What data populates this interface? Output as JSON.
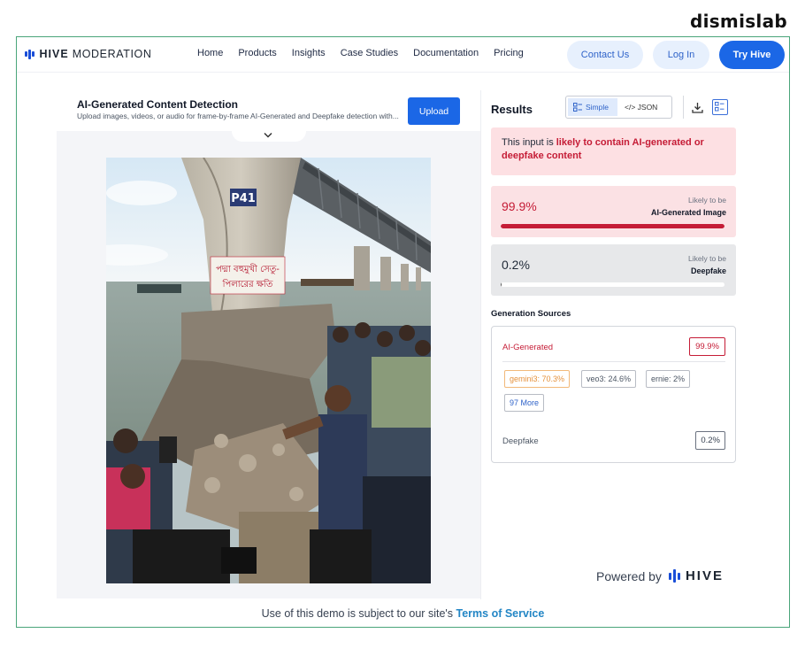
{
  "watermark": "dismislab",
  "header": {
    "brand_bold": "HIVE",
    "brand_rest": "MODERATION",
    "nav": [
      "Home",
      "Products",
      "Insights",
      "Case Studies",
      "Documentation",
      "Pricing"
    ],
    "contact_label": "Contact Us",
    "login_label": "Log In",
    "try_label": "Try Hive"
  },
  "detector": {
    "title": "AI-Generated Content Detection",
    "subtitle": "Upload images, videos, or audio for frame-by-frame AI-Generated and Deepfake detection with...",
    "upload_label": "Upload",
    "photo": {
      "pillar_code": "P41",
      "banner_line1": "পদ্মা বহুমুখী সেতু-",
      "banner_line2": "পিলারের ক্ষতি"
    }
  },
  "results": {
    "title": "Results",
    "view_simple": "Simple",
    "view_json": "</> JSON",
    "alert_prefix": "This input is ",
    "alert_highlight": "likely to contain AI-generated or deepfake content",
    "ai_score": {
      "percent_label": "99.9%",
      "likely": "Likely to be",
      "label": "AI-Generated Image",
      "fill_fraction": 0.999
    },
    "deepfake_score": {
      "percent_label": "0.2%",
      "likely": "Likely to be",
      "label": "Deepfake",
      "fill_fraction": 0.002
    },
    "generation_sources": {
      "title": "Generation Sources",
      "ai_label": "AI-Generated",
      "ai_pct": "99.9%",
      "chips": [
        "gemini3: 70.3%",
        "veo3: 24.6%",
        "ernie: 2%"
      ],
      "more_label": "97 More",
      "deepfake_label": "Deepfake",
      "deepfake_pct": "0.2%"
    },
    "powered_by": "Powered by",
    "powered_brand": "HIVE"
  },
  "footer": {
    "text": "Use of this demo is subject to our site's",
    "link": "Terms of Service"
  },
  "colors": {
    "brand_blue": "#1b67e6",
    "alert_red": "#c51c36",
    "frame_green": "#4aa57a",
    "chip_orange": "#e5913b"
  }
}
